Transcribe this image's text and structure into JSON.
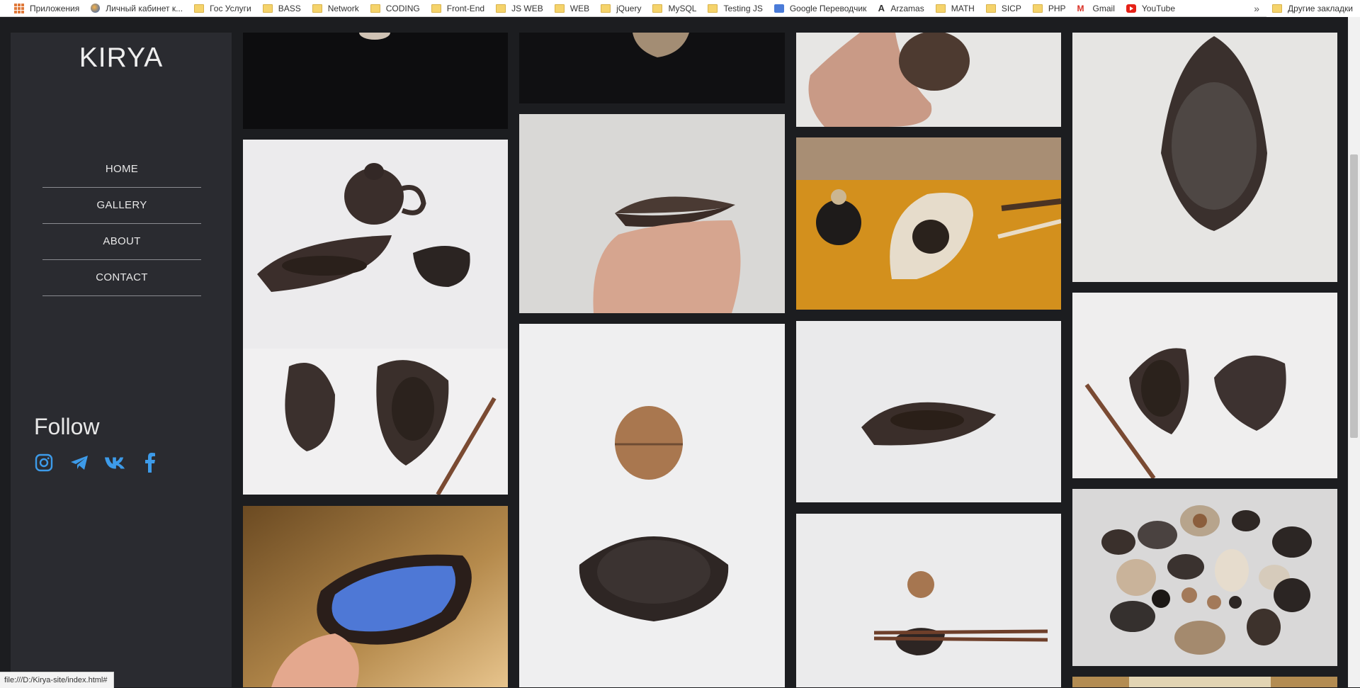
{
  "bookmarks": {
    "items": [
      {
        "label": "Приложения",
        "icon": "apps-grid-icon"
      },
      {
        "label": "Личный кабинет к...",
        "icon": "globe-icon"
      },
      {
        "label": "Гос Услуги",
        "icon": "folder-icon"
      },
      {
        "label": "BASS",
        "icon": "folder-icon"
      },
      {
        "label": "Network",
        "icon": "folder-icon"
      },
      {
        "label": "CODING",
        "icon": "folder-icon"
      },
      {
        "label": "Front-End",
        "icon": "folder-icon"
      },
      {
        "label": "JS WEB",
        "icon": "folder-icon"
      },
      {
        "label": "WEB",
        "icon": "folder-icon"
      },
      {
        "label": "jQuery",
        "icon": "folder-icon"
      },
      {
        "label": "MySQL",
        "icon": "folder-icon"
      },
      {
        "label": "Testing JS",
        "icon": "folder-icon"
      },
      {
        "label": "Google Переводчик",
        "icon": "google-translate-icon"
      },
      {
        "label": "Arzamas",
        "icon": "arzamas-icon"
      },
      {
        "label": "MATH",
        "icon": "folder-icon"
      },
      {
        "label": "SICP",
        "icon": "folder-icon"
      },
      {
        "label": "PHP",
        "icon": "folder-icon"
      },
      {
        "label": "Gmail",
        "icon": "gmail-icon"
      },
      {
        "label": "YouTube",
        "icon": "youtube-icon"
      }
    ],
    "more": "»",
    "other": "Другие закладки"
  },
  "sidebar": {
    "logo": "KIRYA",
    "nav": [
      "HOME",
      "GALLERY",
      "ABOUT",
      "CONTACT"
    ],
    "follow": "Follow",
    "socials": [
      "instagram-icon",
      "telegram-icon",
      "vk-icon",
      "facebook-icon"
    ],
    "social_color": "#3d9be9"
  },
  "gallery": {
    "photos": [
      {
        "name": "photo-dark-top-1",
        "subject": "ceramic piece on black background"
      },
      {
        "name": "photo-teaset",
        "subject": "teapot, cup and tea bowl"
      },
      {
        "name": "photo-blue-bowl",
        "subject": "hand holding blue glazed bowl"
      },
      {
        "name": "photo-dark-top-2",
        "subject": "ceramic piece on black background"
      },
      {
        "name": "photo-walnut-dish-hand",
        "subject": "hand holding walnut-shaped dish"
      },
      {
        "name": "photo-walnut-bowl",
        "subject": "walnut and black bowl"
      },
      {
        "name": "photo-hand-walnut-stone",
        "subject": "hand with walnut-shaped stone"
      },
      {
        "name": "photo-tea-ceremony",
        "subject": "tea bowl on yellow cloth"
      },
      {
        "name": "photo-leaf-dish-tea",
        "subject": "leaf dish with tea leaves"
      },
      {
        "name": "photo-chopstick-rest",
        "subject": "walnut and chopsticks on rest"
      },
      {
        "name": "photo-big-bowl",
        "subject": "large dark glazed bowl"
      },
      {
        "name": "photo-two-dishes",
        "subject": "two dark dishes with chopstick"
      },
      {
        "name": "photo-collection",
        "subject": "collection of ceramic dishes"
      },
      {
        "name": "photo-bottom-partial",
        "subject": "partially visible photo"
      }
    ]
  },
  "status_bar": "file:///D:/Kirya-site/index.html#",
  "colors": {
    "page_bg": "#1c1d20",
    "sidebar_bg": "#2a2b30",
    "accent": "#3d9be9"
  }
}
